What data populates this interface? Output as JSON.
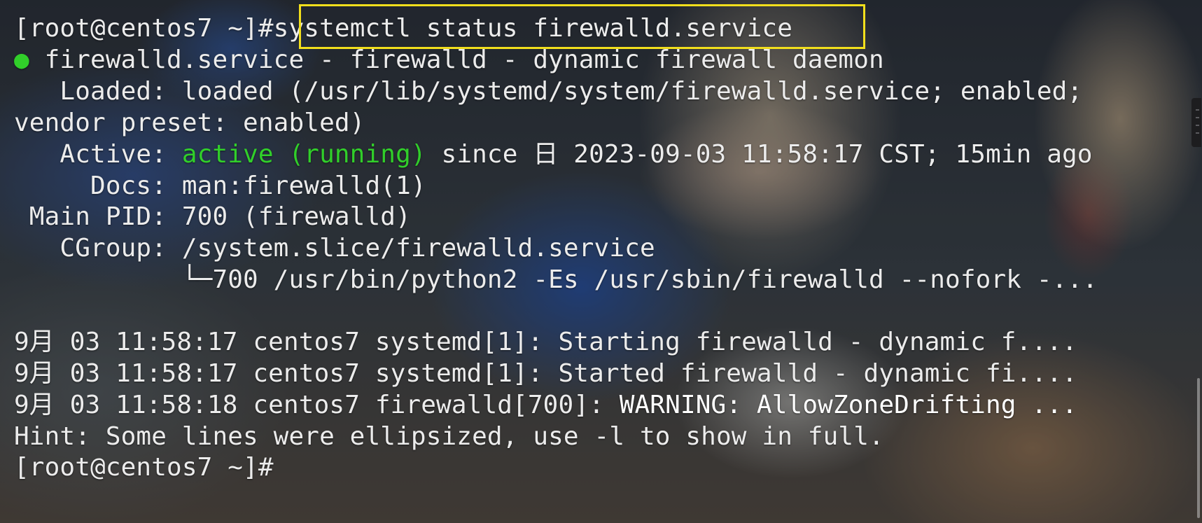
{
  "terminal": {
    "prompt": "[root@centos7 ~]#",
    "command": "systemctl status firewalld.service",
    "status_dot": "●",
    "service_line": " firewalld.service - firewalld - dynamic firewall daemon",
    "loaded_line_1": "   Loaded: loaded (/usr/lib/systemd/system/firewalld.service; enabled;",
    "loaded_line_2": "vendor preset: enabled)",
    "active_label": "   Active: ",
    "active_state": "active (running)",
    "active_since": " since 日 2023-09-03 11:58:17 CST; 15min ago",
    "docs_line": "     Docs: man:firewalld(1)",
    "main_pid_line": " Main PID: 700 (firewalld)",
    "cgroup_line": "   CGroup: /system.slice/firewalld.service",
    "cgroup_process_line": "           └─700 /usr/bin/python2 -Es /usr/sbin/firewalld --nofork -...",
    "log_line_1": "9月 03 11:58:17 centos7 systemd[1]: Starting firewalld - dynamic f....",
    "log_line_2": "9月 03 11:58:17 centos7 systemd[1]: Started firewalld - dynamic fi....",
    "log_line_3_prefix": "9月 03 11:58:18 centos7 firewalld[700]: ",
    "log_line_3_message": "WARNING: AllowZoneDrifting ...",
    "hint_line": "Hint: Some lines were ellipsized, use -l to show in full.",
    "final_prompt": "[root@centos7 ~]#"
  },
  "colors": {
    "text": "#ececec",
    "active_green": "#31cf2a",
    "highlight_yellow": "#f2df1c"
  }
}
